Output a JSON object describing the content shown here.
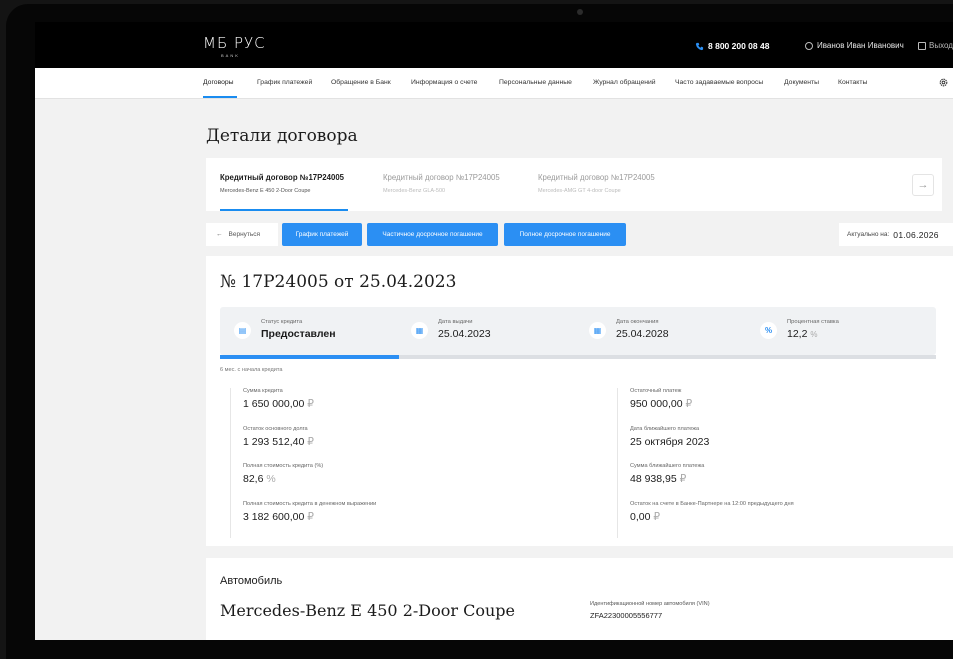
{
  "header": {
    "logo": "МБ РУС",
    "logo_sub": "BANK",
    "phone": "8 800 200 08 48",
    "user": "Иванов Иван Иванович",
    "logout": "Выход"
  },
  "nav": {
    "items": [
      {
        "label": "Договоры",
        "active": true
      },
      {
        "label": "График платежей"
      },
      {
        "label": "Обращение в Банк"
      },
      {
        "label": "Информация о счете"
      },
      {
        "label": "Персональные данные"
      },
      {
        "label": "Журнал обращений"
      },
      {
        "label": "Часто задаваемые вопросы"
      },
      {
        "label": "Документы"
      },
      {
        "label": "Контакты"
      }
    ]
  },
  "page_title": "Детали договора",
  "contracts": [
    {
      "title": "Кредитный договор №17P24005",
      "car": "Mercedes-Benz E 450 2-Door Coupe",
      "active": true
    },
    {
      "title": "Кредитный договор №17P24005",
      "car": "Mercedes-Benz GLA-500"
    },
    {
      "title": "Кредитный договор №17P24005",
      "car": "Mercedes-AMG GT 4-door Coupe"
    }
  ],
  "actions": {
    "back": "Вернуться",
    "schedule": "График платежей",
    "partial": "Частичное досрочное погашение",
    "full": "Полное досрочное погашение",
    "actual_label": "Актуально на:",
    "actual_date": "01.06.2026"
  },
  "contract": {
    "number": "№ 17P24005 от 25.04.2023",
    "status_label": "Статус кредита",
    "status_value": "Предоставлен",
    "issue_label": "Дата выдачи",
    "issue_value": "25.04.2023",
    "end_label": "Дата окончания",
    "end_value": "25.04.2028",
    "rate_label": "Процентная ставка",
    "rate_value": "12,2",
    "rate_unit": "%",
    "progress_fraction": 0.25,
    "progress_caption": "6 мес. с начала кредита"
  },
  "details_left": [
    {
      "label": "Сумма кредита",
      "value": "1 650 000,00",
      "unit": "₽"
    },
    {
      "label": "Остаток основного долга",
      "value": "1 293 512,40",
      "unit": "₽"
    },
    {
      "label": "Полная стоимость кредита (%)",
      "value": "82,6",
      "unit": "%"
    },
    {
      "label": "Полная стоимость кредита в денежном выражении",
      "value": "3 182 600,00",
      "unit": "₽"
    }
  ],
  "details_right": [
    {
      "label": "Остаточный платеж",
      "value": "950 000,00",
      "unit": "₽"
    },
    {
      "label": "Дата ближайшего платежа",
      "value": "25 октября 2023",
      "unit": ""
    },
    {
      "label": "Сумма ближайшего платежа",
      "value": "48 938,95",
      "unit": "₽"
    },
    {
      "label": "Остаток на счете в Банке-Партнере на 12:00 предыдущего дня",
      "value": "0,00",
      "unit": "₽"
    }
  ],
  "car": {
    "section_title": "Автомобиль",
    "model": "Mercedes-Benz E 450 2-Door Coupe",
    "vin_label": "Идентификационной номер автомобиля (VIN)",
    "vin": "ZFA22300005556777"
  },
  "colors": {
    "accent": "#2b8ff3",
    "topbar": "#000000",
    "background": "#f2f2f2"
  }
}
